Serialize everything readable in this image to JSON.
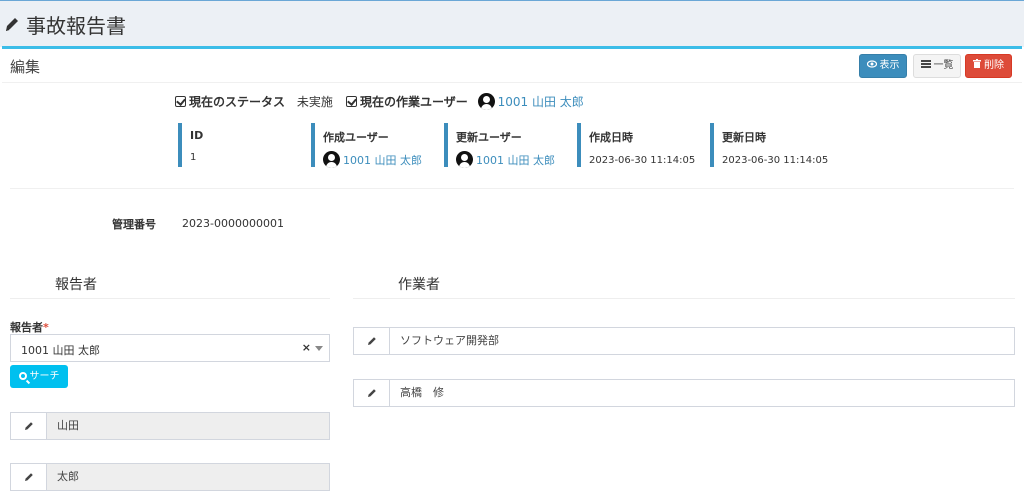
{
  "header": {
    "title": "事故報告書",
    "icon": "pencil-icon"
  },
  "box": {
    "title": "編集"
  },
  "toolbar": {
    "view_label": "表示",
    "list_label": "一覧",
    "delete_label": "削除"
  },
  "status": {
    "status_label": "現在のステータス",
    "status_value": "未実施",
    "worker_label": "現在の作業ユーザー",
    "worker_value": "1001 山田 太郎"
  },
  "info": [
    {
      "label": "ID",
      "value": "1"
    },
    {
      "label": "作成ユーザー",
      "value": "1001 山田 太郎"
    },
    {
      "label": "更新ユーザー",
      "value": "1001 山田 太郎"
    },
    {
      "label": "作成日時",
      "value": "2023-06-30 11:14:05"
    },
    {
      "label": "更新日時",
      "value": "2023-06-30 11:14:05"
    }
  ],
  "management": {
    "label": "管理番号",
    "value": "2023-0000000001"
  },
  "reporter": {
    "section_title": "報告者",
    "field_label": "報告者",
    "required_mark": "*",
    "selected_value": "1001 山田 太郎",
    "clear_label": "×",
    "search_label": "サーチ",
    "last_name": "山田",
    "first_name": "太郎"
  },
  "worker": {
    "section_title": "作業者",
    "department": "ソフトウェア開発部",
    "name": "高橋　修"
  },
  "colors": {
    "primary": "#3c8dbc",
    "danger": "#dd4b39",
    "info": "#00c0ef",
    "box_border": "#3cbde8"
  }
}
